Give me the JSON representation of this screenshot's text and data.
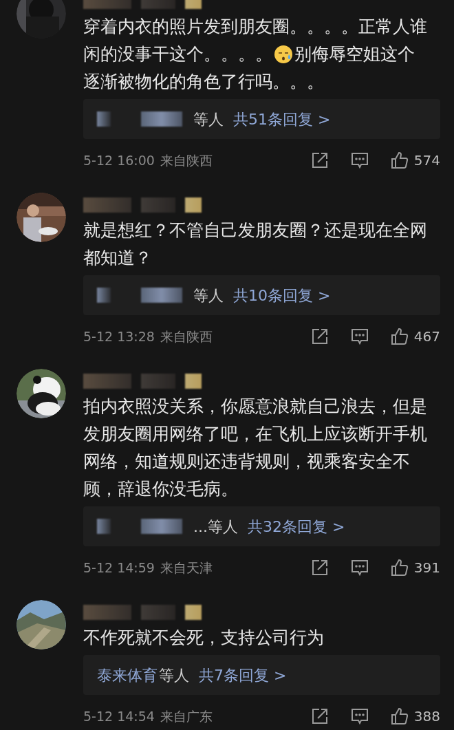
{
  "comments": [
    {
      "avatar": {
        "kind": "picture"
      },
      "name_redacted": true,
      "body": [
        [
          {
            "kind": "text",
            "text": "穿着内衣的照片发到朋友圈。。。。正常人谁"
          }
        ],
        [
          {
            "kind": "text",
            "text": "闲的没事干这个。。。。"
          },
          {
            "kind": "emoji"
          },
          {
            "kind": "text",
            "text": "别侮辱空姐这个"
          }
        ],
        [
          {
            "kind": "text",
            "text": "逐渐被物化的角色了行吗。。。"
          }
        ]
      ],
      "replies": {
        "names_redacted": true,
        "others": "等人",
        "link": "共51条回复 >"
      },
      "date": "5-12 16:00",
      "location": "来自陕西",
      "likes": "574"
    },
    {
      "avatar": {
        "kind": "picture"
      },
      "name_redacted": true,
      "body": [
        [
          {
            "kind": "text",
            "text": "就是想红？不管自己发朋友圈？还是现在全网"
          }
        ],
        [
          {
            "kind": "text",
            "text": "都知道？"
          }
        ]
      ],
      "replies": {
        "names_redacted": true,
        "others": "等人",
        "link": "共10条回复 >"
      },
      "date": "5-12 13:28",
      "location": "来自陕西",
      "likes": "467"
    },
    {
      "avatar": {
        "kind": "picture"
      },
      "name_redacted": true,
      "body": [
        [
          {
            "kind": "text",
            "text": "拍内衣照没关系，你愿意浪就自己浪去，但是"
          }
        ],
        [
          {
            "kind": "text",
            "text": "发朋友圈用网络了吧，在飞机上应该断开手机"
          }
        ],
        [
          {
            "kind": "text",
            "text": "网络，知道规则还违背规则，视乘客安全不"
          }
        ],
        [
          {
            "kind": "text",
            "text": "顾，辞退你没毛病。"
          }
        ]
      ],
      "replies": {
        "names_redacted": true,
        "others": "...等人",
        "link": "共32条回复 >"
      },
      "date": "5-12 14:59",
      "location": "来自天津",
      "likes": "391"
    },
    {
      "avatar": {
        "kind": "picture"
      },
      "name_redacted": true,
      "body": [
        [
          {
            "kind": "text",
            "text": "不作死就不会死，支持公司行为"
          }
        ]
      ],
      "replies": {
        "names_redacted": false,
        "names": "泰来体育",
        "others": "等人",
        "link": "共7条回复 >"
      },
      "date": "5-12 14:54",
      "location": "来自广东",
      "likes": "388"
    }
  ]
}
